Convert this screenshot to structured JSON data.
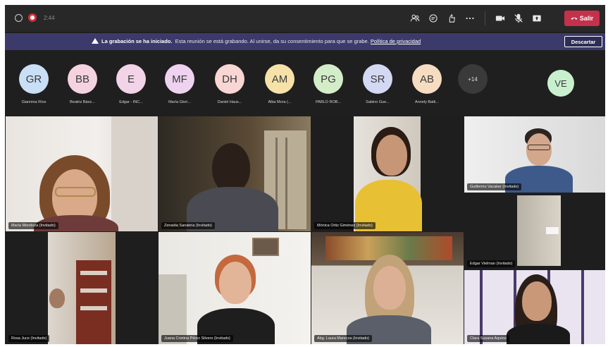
{
  "topbar": {
    "timer": "2:44",
    "leave_label": "Salir",
    "icons": [
      "participants-icon",
      "chat-icon",
      "react-icon",
      "more-icon",
      "camera-icon",
      "mic-icon",
      "share-icon"
    ]
  },
  "banner": {
    "title": "La grabación se ha iniciado.",
    "text": "Esta reunión se está grabando. Al unirse, da su consentimiento para que se grabe.",
    "link": "Política de privacidad",
    "dismiss_label": "Descartar"
  },
  "participants": [
    {
      "initials": "GR",
      "name": "Giannina Ríos",
      "color": "#c8dff5"
    },
    {
      "initials": "BB",
      "name": "Beatriz Báez...",
      "color": "#f5d2df"
    },
    {
      "initials": "E",
      "name": "Edgar - INC...",
      "color": "#f2d3e8"
    },
    {
      "initials": "MF",
      "name": "María Glori...",
      "color": "#efd2f0"
    },
    {
      "initials": "DH",
      "name": "Daniel Haus...",
      "color": "#f8d6d3"
    },
    {
      "initials": "AM",
      "name": "Alba Mora (...",
      "color": "#f6e2a8"
    },
    {
      "initials": "PG",
      "name": "PABLO ROB...",
      "color": "#d4edc9"
    },
    {
      "initials": "SR",
      "name": "Sabino Gue...",
      "color": "#d3d8f3"
    },
    {
      "initials": "AB",
      "name": "Annely Batti...",
      "color": "#f6dcc1"
    }
  ],
  "more_count": "+14",
  "extra_avatar": {
    "initials": "VE",
    "color": "#c9f0ce"
  },
  "tiles": {
    "t1": "María Mendoza (Invitado)",
    "t2": "Zenaida Sanabria (Invitado)",
    "t3": "Mónica Ortiz Giménez (Invitado)",
    "t4": "Guillermo Vacaker (Invitado)",
    "t5": "Edgar Vielman (Invitado)",
    "t6": "Rosa Juce (Invitado)",
    "t7": "Juana Cristina Pérez Silvero (Invitado)",
    "t8": "Abg. Laura Marecos (Invitado)",
    "t9": "Clara Susana Aquino"
  }
}
